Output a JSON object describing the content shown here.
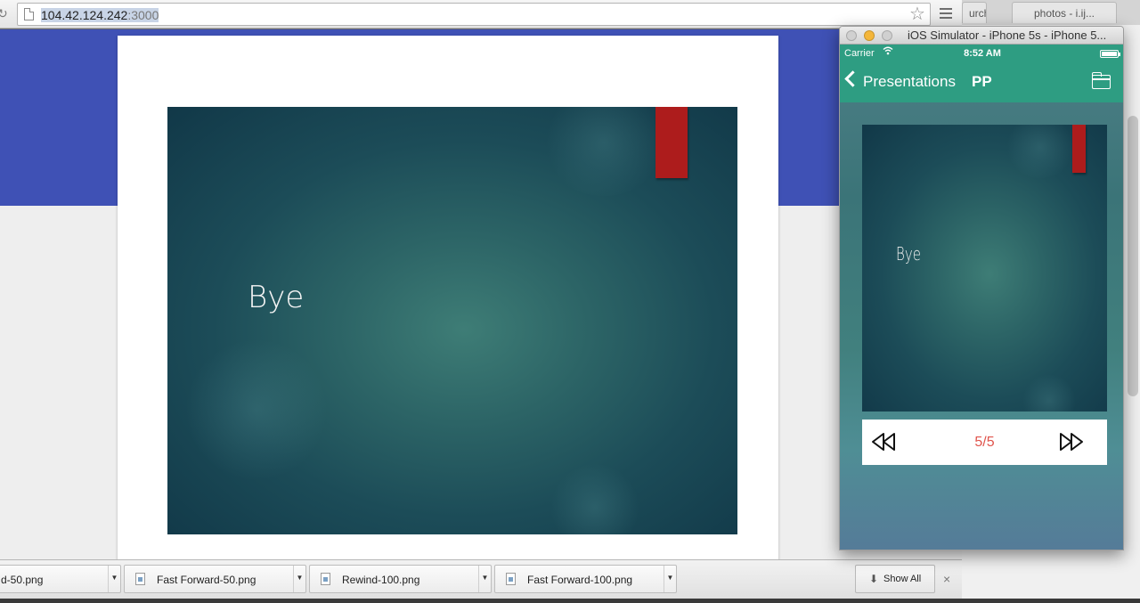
{
  "browser": {
    "url_host": "104.42.124.242",
    "url_port": ":3000",
    "tabs": [
      {
        "label": "urch..."
      },
      {
        "label": "photos - i.ij..."
      }
    ]
  },
  "webpage": {
    "slide_text": "Bye"
  },
  "downloads": {
    "items": [
      {
        "name": "d-50.png"
      },
      {
        "name": "Fast Forward-50.png"
      },
      {
        "name": "Rewind-100.png"
      },
      {
        "name": "Fast Forward-100.png"
      }
    ],
    "show_all_label": "Show All",
    "close_label": "×"
  },
  "simulator": {
    "window_title": "iOS Simulator - iPhone 5s - iPhone 5...",
    "status": {
      "carrier": "Carrier",
      "time": "8:52 AM"
    },
    "navbar": {
      "back_label": "Presentations",
      "title": "PP"
    },
    "slide_text": "Bye",
    "page_counter": "5/5"
  },
  "colors": {
    "page_band": "#3f51b5",
    "ios_accent": "#2e9d82",
    "ribbon": "#ad1c1c",
    "counter": "#e0544c"
  }
}
